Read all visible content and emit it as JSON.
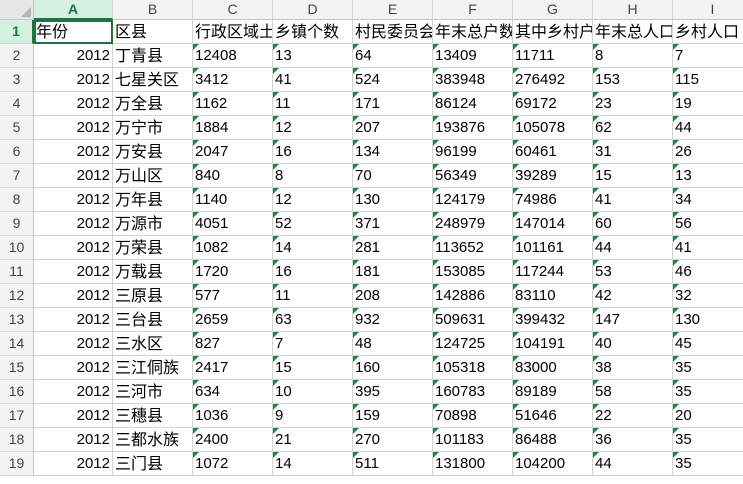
{
  "columns": [
    "A",
    "B",
    "C",
    "D",
    "E",
    "F",
    "G",
    "H",
    "I"
  ],
  "column_widths": [
    79,
    80,
    80,
    80,
    80,
    80,
    80,
    80,
    80
  ],
  "selected_column": "A",
  "selected_row": "1",
  "header_row": [
    "年份",
    "区县",
    "行政区域土",
    "乡镇个数",
    "村民委员会",
    "年末总户数",
    "其中乡村户",
    "年末总人口",
    "乡村人口"
  ],
  "rows": [
    [
      "2012",
      "丁青县",
      "12408",
      "13",
      "64",
      "13409",
      "11711",
      "8",
      "7"
    ],
    [
      "2012",
      "七星关区",
      "3412",
      "41",
      "524",
      "383948",
      "276492",
      "153",
      "115"
    ],
    [
      "2012",
      "万全县",
      "1162",
      "11",
      "171",
      "86124",
      "69172",
      "23",
      "19"
    ],
    [
      "2012",
      "万宁市",
      "1884",
      "12",
      "207",
      "193876",
      "105078",
      "62",
      "44"
    ],
    [
      "2012",
      "万安县",
      "2047",
      "16",
      "134",
      "96199",
      "60461",
      "31",
      "26"
    ],
    [
      "2012",
      "万山区",
      "840",
      "8",
      "70",
      "56349",
      "39289",
      "15",
      "13"
    ],
    [
      "2012",
      "万年县",
      "1140",
      "12",
      "130",
      "124179",
      "74986",
      "41",
      "34"
    ],
    [
      "2012",
      "万源市",
      "4051",
      "52",
      "371",
      "248979",
      "147014",
      "60",
      "56"
    ],
    [
      "2012",
      "万荣县",
      "1082",
      "14",
      "281",
      "113652",
      "101161",
      "44",
      "41"
    ],
    [
      "2012",
      "万载县",
      "1720",
      "16",
      "181",
      "153085",
      "117244",
      "53",
      "46"
    ],
    [
      "2012",
      "三原县",
      "577",
      "11",
      "208",
      "142886",
      "83110",
      "42",
      "32"
    ],
    [
      "2012",
      "三台县",
      "2659",
      "63",
      "932",
      "509631",
      "399432",
      "147",
      "130"
    ],
    [
      "2012",
      "三水区",
      "827",
      "7",
      "48",
      "124725",
      "104191",
      "40",
      "45"
    ],
    [
      "2012",
      "三江侗族",
      "2417",
      "15",
      "160",
      "105318",
      "83000",
      "38",
      "35"
    ],
    [
      "2012",
      "三河市",
      "634",
      "10",
      "395",
      "160783",
      "89189",
      "58",
      "35"
    ],
    [
      "2012",
      "三穗县",
      "1036",
      "9",
      "159",
      "70898",
      "51646",
      "22",
      "20"
    ],
    [
      "2012",
      "三都水族",
      "2400",
      "21",
      "270",
      "101183",
      "86488",
      "36",
      "35"
    ],
    [
      "2012",
      "三门县",
      "1072",
      "14",
      "511",
      "131800",
      "104200",
      "44",
      "35"
    ]
  ]
}
